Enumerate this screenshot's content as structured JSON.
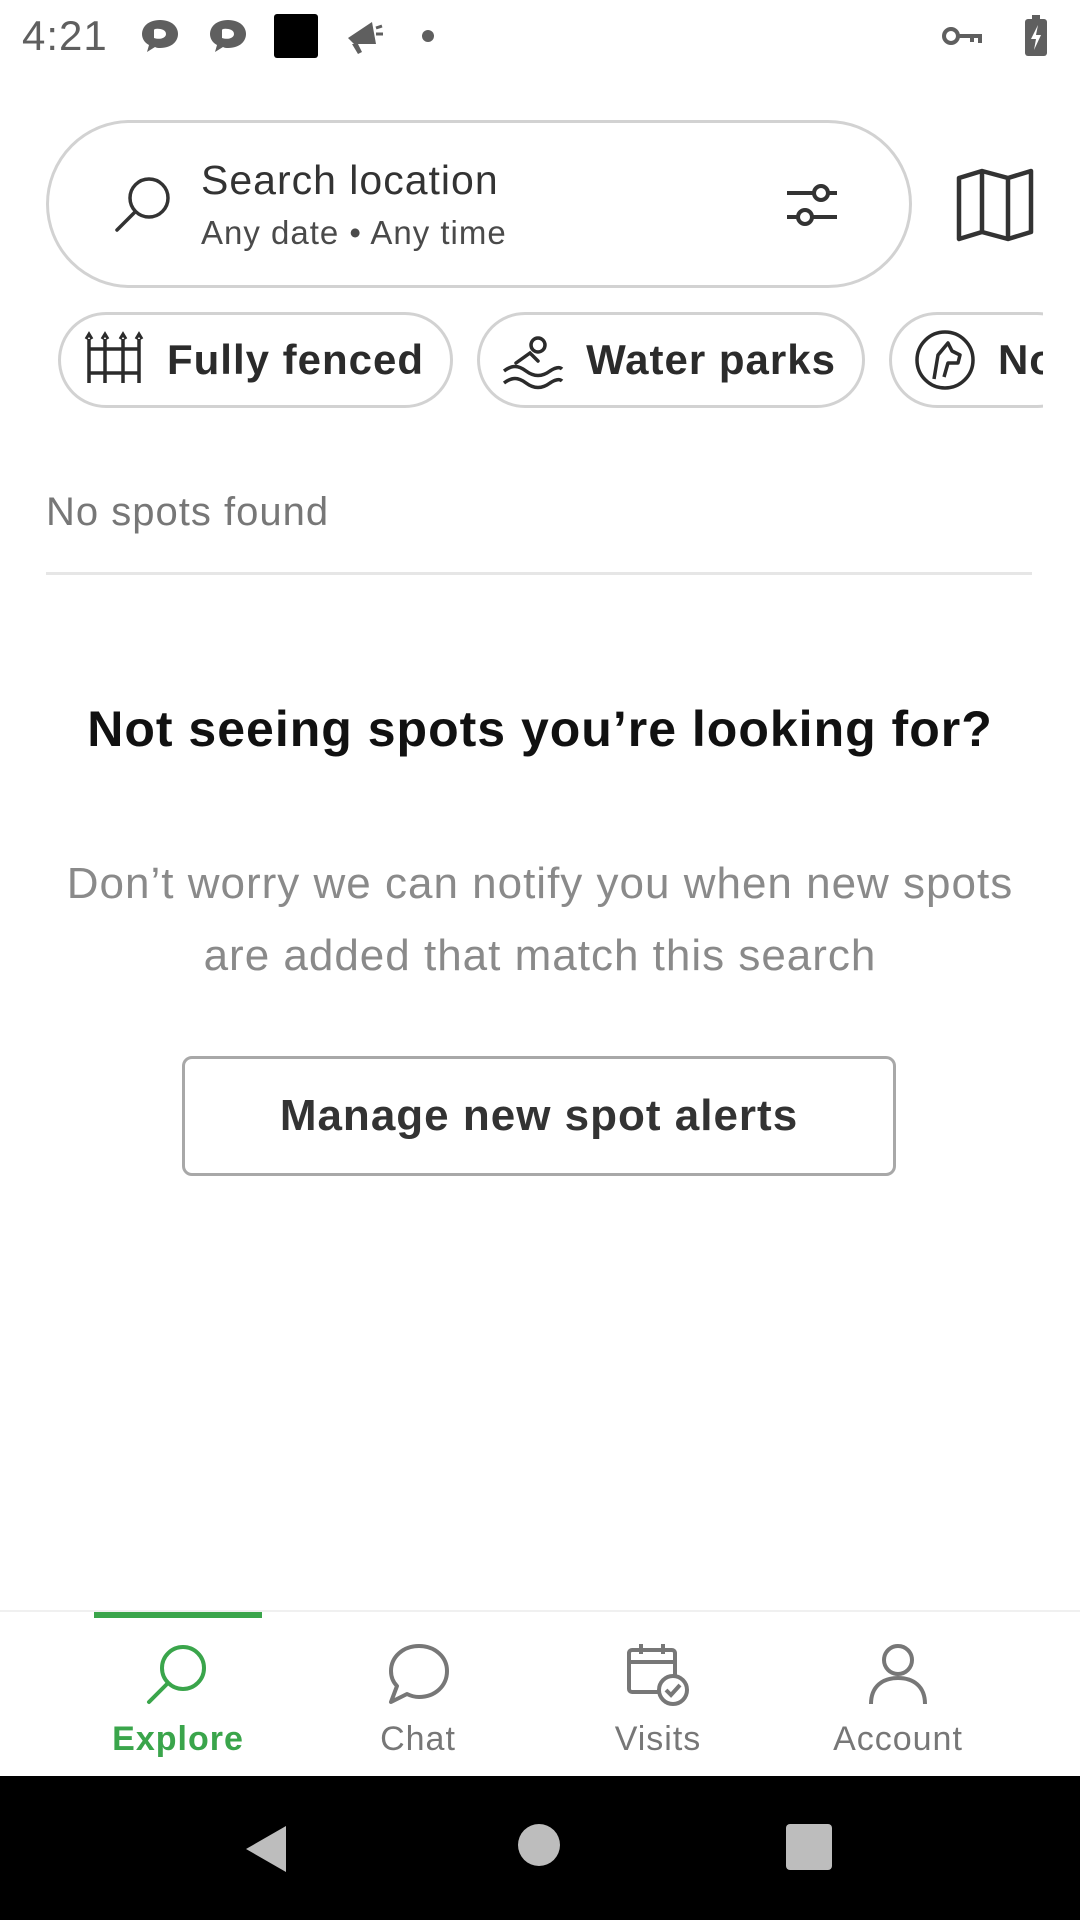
{
  "status_bar": {
    "time": "4:21",
    "left_icons": [
      "chat-bubble-icon",
      "chat-bubble-icon",
      "black-square-icon",
      "megaphone-icon",
      "dot-icon"
    ],
    "right_icons": [
      "vpn-key-icon",
      "battery-charging-icon"
    ]
  },
  "search": {
    "title": "Search location",
    "subtitle": "Any date • Any time"
  },
  "chips": [
    {
      "label": "Fully fenced",
      "icon": "fence-icon"
    },
    {
      "label": "Water parks",
      "icon": "swimming-icon"
    },
    {
      "label": "No",
      "icon": "dog-icon"
    }
  ],
  "results": {
    "header": "No spots found"
  },
  "empty_state": {
    "title": "Not seeing spots you’re looking for?",
    "body": "Don’t worry we can notify you when new spots are added that match this search",
    "button_label": "Manage new spot alerts"
  },
  "bottom_nav": {
    "items": [
      {
        "label": "Explore",
        "icon": "search-icon",
        "active": true
      },
      {
        "label": "Chat",
        "icon": "chat-icon",
        "active": false
      },
      {
        "label": "Visits",
        "icon": "calendar-check-icon",
        "active": false
      },
      {
        "label": "Account",
        "icon": "person-icon",
        "active": false
      }
    ]
  },
  "colors": {
    "accent": "#3aa54b",
    "border": "#d2d2d2",
    "muted_text": "#8a8a8a"
  }
}
